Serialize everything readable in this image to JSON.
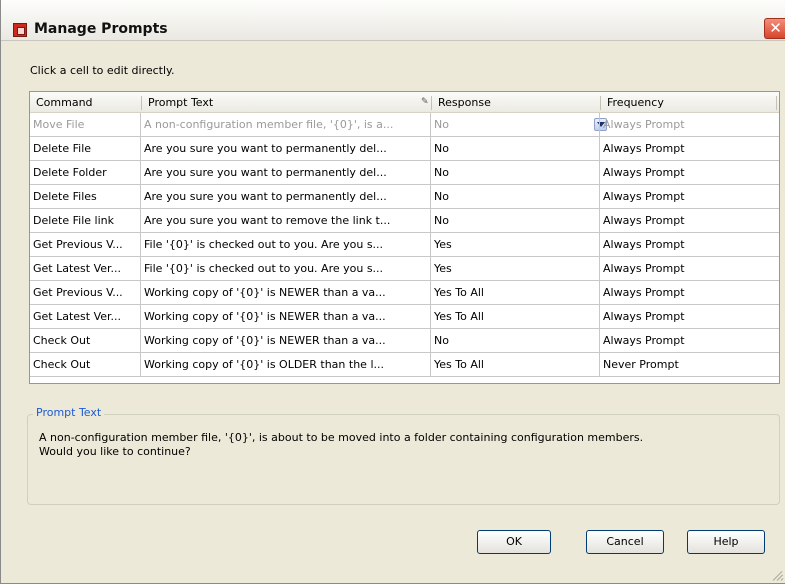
{
  "window": {
    "title": "Manage Prompts",
    "close_glyph": "✕"
  },
  "instruction": "Click a cell to edit directly.",
  "grid": {
    "columns": [
      "Command",
      "Prompt Text",
      "Response",
      "Frequency"
    ],
    "rows": [
      {
        "command": "Move File",
        "prompt": "A non-configuration member file, '{0}', is a...",
        "response": "No",
        "frequency": "Always Prompt"
      },
      {
        "command": "Delete File",
        "prompt": "Are you sure you want to permanently del...",
        "response": "No",
        "frequency": "Always Prompt"
      },
      {
        "command": "Delete Folder",
        "prompt": "Are you sure you want to permanently del...",
        "response": "No",
        "frequency": "Always Prompt"
      },
      {
        "command": "Delete Files",
        "prompt": "Are you sure you want to permanently del...",
        "response": "No",
        "frequency": "Always Prompt"
      },
      {
        "command": "Delete File link",
        "prompt": "Are you sure you want to remove the link t...",
        "response": "No",
        "frequency": "Always Prompt"
      },
      {
        "command": "Get Previous V...",
        "prompt": "File '{0}' is checked out to you.  Are you s...",
        "response": "Yes",
        "frequency": "Always Prompt"
      },
      {
        "command": "Get Latest Ver...",
        "prompt": "File '{0}' is checked out to you.  Are you s...",
        "response": "Yes",
        "frequency": "Always Prompt"
      },
      {
        "command": "Get Previous V...",
        "prompt": "Working copy of '{0}' is NEWER than a va...",
        "response": "Yes To All",
        "frequency": "Always Prompt"
      },
      {
        "command": "Get Latest Ver...",
        "prompt": "Working copy of '{0}' is NEWER than a va...",
        "response": "Yes To All",
        "frequency": "Always Prompt"
      },
      {
        "command": "Check Out",
        "prompt": "Working copy of '{0}' is NEWER than a va...",
        "response": "No",
        "frequency": "Always Prompt"
      },
      {
        "command": "Check Out",
        "prompt": "Working copy of '{0}' is OLDER than the l...",
        "response": "Yes To All",
        "frequency": "Never Prompt"
      }
    ]
  },
  "details": {
    "legend": "Prompt Text",
    "text": "A non-configuration member file, '{0}', is about to be moved into a folder containing configuration members.\nWould you like to continue?"
  },
  "buttons": {
    "ok": "OK",
    "cancel": "Cancel",
    "help": "Help"
  },
  "colors": {
    "accent": "#1b5bd3",
    "close": "#d9452b",
    "dialog_bg": "#ece9d8",
    "disabled_text": "#9a9a9a"
  },
  "icons": {
    "app": "manage-prompts-app-icon",
    "close": "close-icon",
    "dropdown": "chevron-down-icon",
    "edit": "edit-pencil-icon",
    "resize": "resize-grip-icon"
  }
}
